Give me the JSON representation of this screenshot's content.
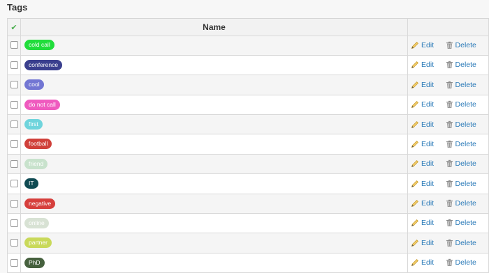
{
  "page": {
    "title": "Tags"
  },
  "table": {
    "header": {
      "select_all_icon": "checkmark-icon",
      "name": "Name"
    },
    "actions": {
      "edit_label": "Edit",
      "delete_label": "Delete",
      "edit_icon": "pencil-icon",
      "delete_icon": "trash-icon"
    },
    "rows": [
      {
        "label": "cold call",
        "color": "#21dd3b"
      },
      {
        "label": "conference",
        "color": "#3a3f8e"
      },
      {
        "label": "cool",
        "color": "#7276d3"
      },
      {
        "label": "do not call",
        "color": "#ef5bbf"
      },
      {
        "label": "first",
        "color": "#6fd4dc"
      },
      {
        "label": "football",
        "color": "#d0403a"
      },
      {
        "label": "friend",
        "color": "#c8e2cc"
      },
      {
        "label": "IT",
        "color": "#0f4a52"
      },
      {
        "label": "negative",
        "color": "#d63f3c"
      },
      {
        "label": "online",
        "color": "#d8e2d4"
      },
      {
        "label": "partner",
        "color": "#c9d95a"
      },
      {
        "label": "PhD",
        "color": "#46613e"
      }
    ]
  }
}
